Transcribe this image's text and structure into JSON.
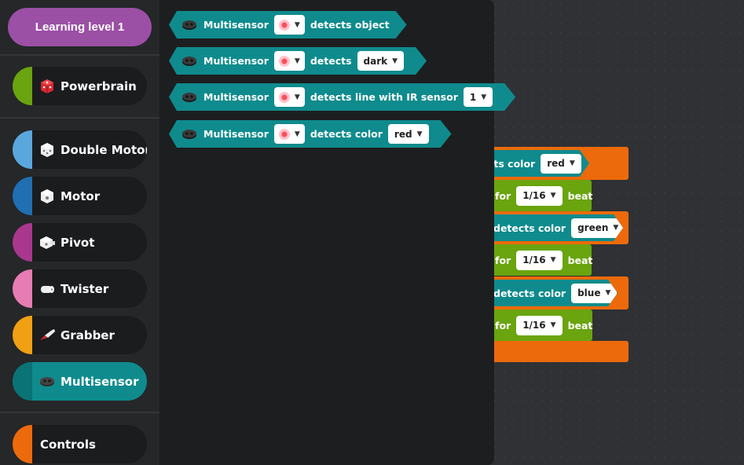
{
  "sidebar": {
    "level_label": "Learning level 1",
    "categories": [
      {
        "label": "Powerbrain",
        "color": "#6aa40e",
        "icon": "powerbrain-icon"
      },
      {
        "label": "Double Motor",
        "color": "#5aa7de",
        "icon": "double-motor-icon"
      },
      {
        "label": "Motor",
        "color": "#1f6fb2",
        "icon": "motor-icon"
      },
      {
        "label": "Pivot",
        "color": "#a9378e",
        "icon": "pivot-icon"
      },
      {
        "label": "Twister",
        "color": "#e77bb3",
        "icon": "twister-icon"
      },
      {
        "label": "Grabber",
        "color": "#f0a012",
        "icon": "grabber-icon"
      },
      {
        "label": "Multisensor",
        "color": "#0f8b8d",
        "icon": "multisensor-icon"
      },
      {
        "label": "Controls",
        "color": "#ec6a0b"
      }
    ]
  },
  "flyout": {
    "blocks": [
      {
        "sensor": "Multisensor",
        "text": "detects object"
      },
      {
        "sensor": "Multisensor",
        "text": "detects",
        "option": "dark"
      },
      {
        "sensor": "Multisensor",
        "text": "detects line with IR sensor",
        "option": "1"
      },
      {
        "sensor": "Multisensor",
        "text": "detects color",
        "option": "red"
      }
    ]
  },
  "workspace": {
    "rows": [
      {
        "kind": "condition",
        "text": "cts color",
        "option": "red"
      },
      {
        "kind": "action",
        "text": "for",
        "option": "1/16",
        "suffix": "beat"
      },
      {
        "kind": "condition",
        "text": "detects color",
        "option": "green"
      },
      {
        "kind": "action",
        "text": "for",
        "option": "1/16",
        "suffix": "beat"
      },
      {
        "kind": "condition",
        "text": "detects color",
        "option": "blue"
      },
      {
        "kind": "action",
        "text": "for",
        "option": "1/16",
        "suffix": "beat"
      }
    ]
  },
  "colors": {
    "teal": "#0f8b8d",
    "orange": "#ec6a0b",
    "green": "#6aa40e",
    "purple": "#9b4fa5"
  }
}
